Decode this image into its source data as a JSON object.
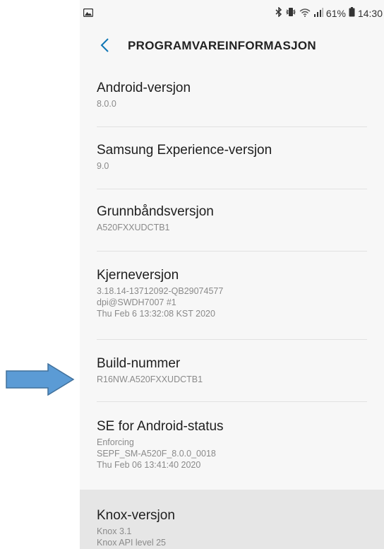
{
  "status_bar": {
    "battery": "61%",
    "time": "14:30",
    "icons": [
      "image-icon",
      "bluetooth-icon",
      "vibrate-icon",
      "wifi-icon",
      "signal-icon",
      "battery-icon"
    ]
  },
  "header": {
    "title": "PROGRAMVAREINFORMASJON",
    "back_icon": "chevron-left-icon"
  },
  "items": [
    {
      "title": "Android-versjon",
      "lines": [
        "8.0.0"
      ]
    },
    {
      "title": "Samsung Experience-versjon",
      "lines": [
        "9.0"
      ]
    },
    {
      "title": "Grunnbåndsversjon",
      "lines": [
        "A520FXXUDCTB1"
      ]
    },
    {
      "title": "Kjerneversjon",
      "lines": [
        "3.18.14-13712092-QB29074577",
        "dpi@SWDH7007 #1",
        "Thu Feb 6 13:32:08 KST 2020"
      ]
    },
    {
      "title": "Build-nummer",
      "lines": [
        "R16NW.A520FXXUDCTB1"
      ]
    },
    {
      "title": "SE for Android-status",
      "lines": [
        "Enforcing",
        "SEPF_SM-A520F_8.0.0_0018",
        "Thu Feb 06 13:41:40 2020"
      ]
    },
    {
      "title": "Knox-versjon",
      "lines": [
        "Knox 3.1",
        "Knox API level 25"
      ]
    }
  ],
  "colors": {
    "accent": "#0f76b5",
    "arrow_fill": "#5b9bd5",
    "arrow_stroke": "#41719c",
    "highlight_row": "#e6e6e6"
  }
}
